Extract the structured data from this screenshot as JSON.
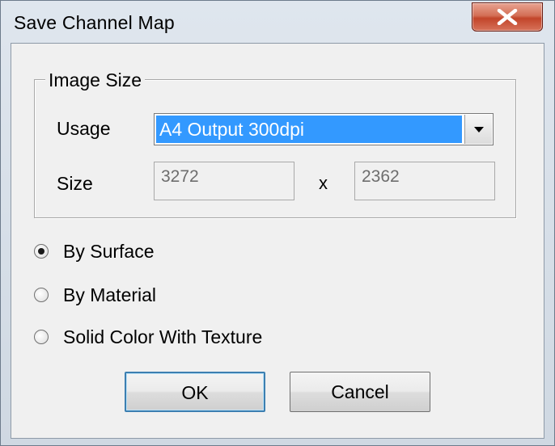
{
  "window": {
    "title": "Save Channel Map"
  },
  "image_size": {
    "group_label": "Image Size",
    "usage_label": "Usage",
    "usage_selected": "A4 Output 300dpi",
    "size_label": "Size",
    "width": "3272",
    "separator": "x",
    "height": "2362"
  },
  "mode": {
    "options": [
      {
        "label": "By Surface",
        "checked": true
      },
      {
        "label": "By Material",
        "checked": false
      },
      {
        "label": "Solid Color With Texture",
        "checked": false
      }
    ]
  },
  "buttons": {
    "ok": "OK",
    "cancel": "Cancel"
  },
  "icons": {
    "close": "close-icon",
    "dropdown": "chevron-down-icon",
    "radio_selected": "radio-dot-icon"
  },
  "colors": {
    "selection": "#3399ff",
    "close_button": "#c2452a",
    "default_button_border": "#3c7fb1"
  }
}
